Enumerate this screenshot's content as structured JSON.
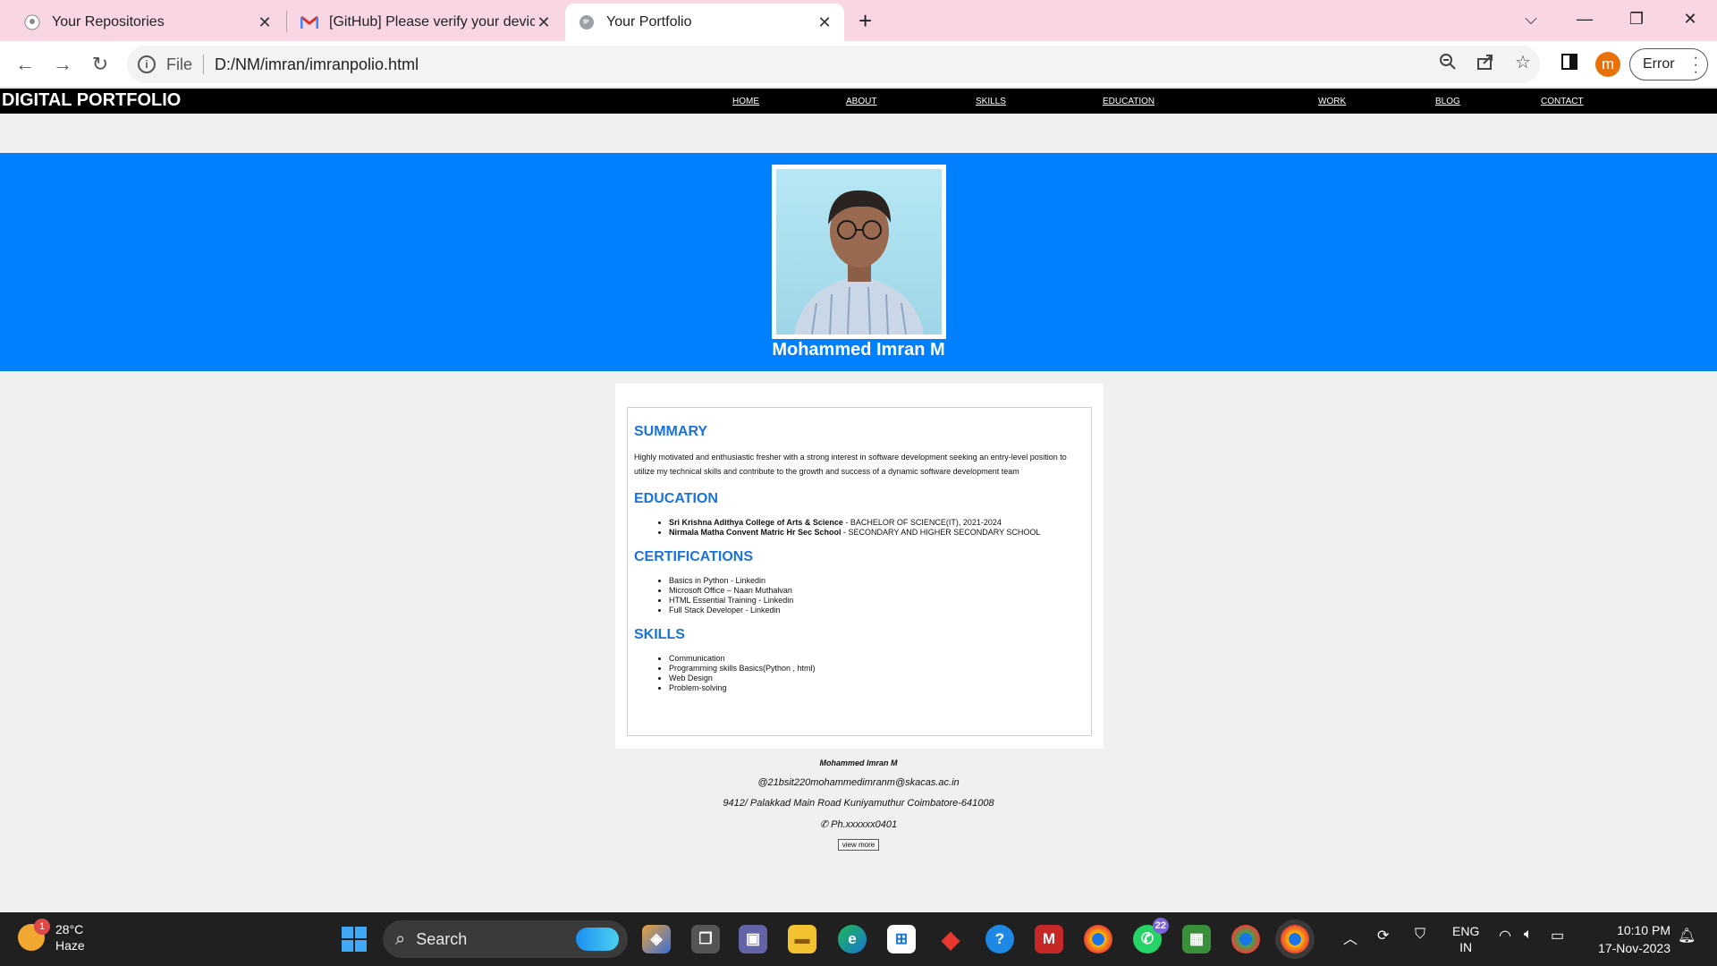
{
  "browser": {
    "tabs": [
      {
        "title": "Your Repositories",
        "icon": "github-icon"
      },
      {
        "title": "[GitHub] Please verify your device",
        "icon": "gmail-icon"
      },
      {
        "title": "Your Portfolio",
        "icon": "globe-icon",
        "active": true
      }
    ],
    "address": {
      "scheme": "File",
      "url": "D:/NM/imran/imranpolio.html"
    },
    "profile_initial": "m",
    "error_label": "Error"
  },
  "site": {
    "brand": "DIGITAL PORTFOLIO",
    "nav": [
      "HOME",
      "ABOUT",
      "SKILLS",
      "EDUCATION",
      "WORK",
      "BLOG",
      "CONTACT"
    ],
    "hero_name": "Mohammed Imran M",
    "hero_bg_color": "#0080ff",
    "summary": {
      "title": "SUMMARY",
      "text": "Highly motivated and enthusiastic fresher with a strong interest in software development seeking an entry-level position to utilize my technical skills and contribute to the growth and success of a dynamic software development team"
    },
    "education": {
      "title": "EDUCATION",
      "items": [
        {
          "school": "Sri Krishna Adithya College of Arts & Science",
          "detail": " - BACHELOR OF SCIENCE(IT), 2021-2024"
        },
        {
          "school": "Nirmala Matha Convent Matric Hr Sec School",
          "detail": " - SECONDARY AND HIGHER SECONDARY SCHOOL"
        }
      ]
    },
    "certifications": {
      "title": "CERTIFICATIONS",
      "items": [
        "Basics in Python - Linkedin",
        "Microsoft Office – Naan Muthalvan",
        "HTML Essential Training - Linkedin",
        "Full Stack Developer - Linkedin"
      ]
    },
    "skills": {
      "title": "SKILLS",
      "items": [
        "Communication",
        "Programming skills Basics(Python , html)",
        "Web Design",
        "Problem-solving"
      ]
    },
    "footer": {
      "name": "Mohammed Imran M",
      "email": "@21bsit220mohammedimranm@skacas.ac.in",
      "address": "9412/ Palakkad Main Road Kuniyamuthur Coimbatore-641008",
      "phone": "✆ Ph.xxxxxx0401",
      "view_more": "view more"
    }
  },
  "taskbar": {
    "weather_temp": "28°C",
    "weather_desc": "Haze",
    "weather_badge": "1",
    "search_label": "Search",
    "whatsapp_badge": "22",
    "lang_line1": "ENG",
    "lang_line2": "IN",
    "time": "10:10 PM",
    "date": "17-Nov-2023"
  }
}
